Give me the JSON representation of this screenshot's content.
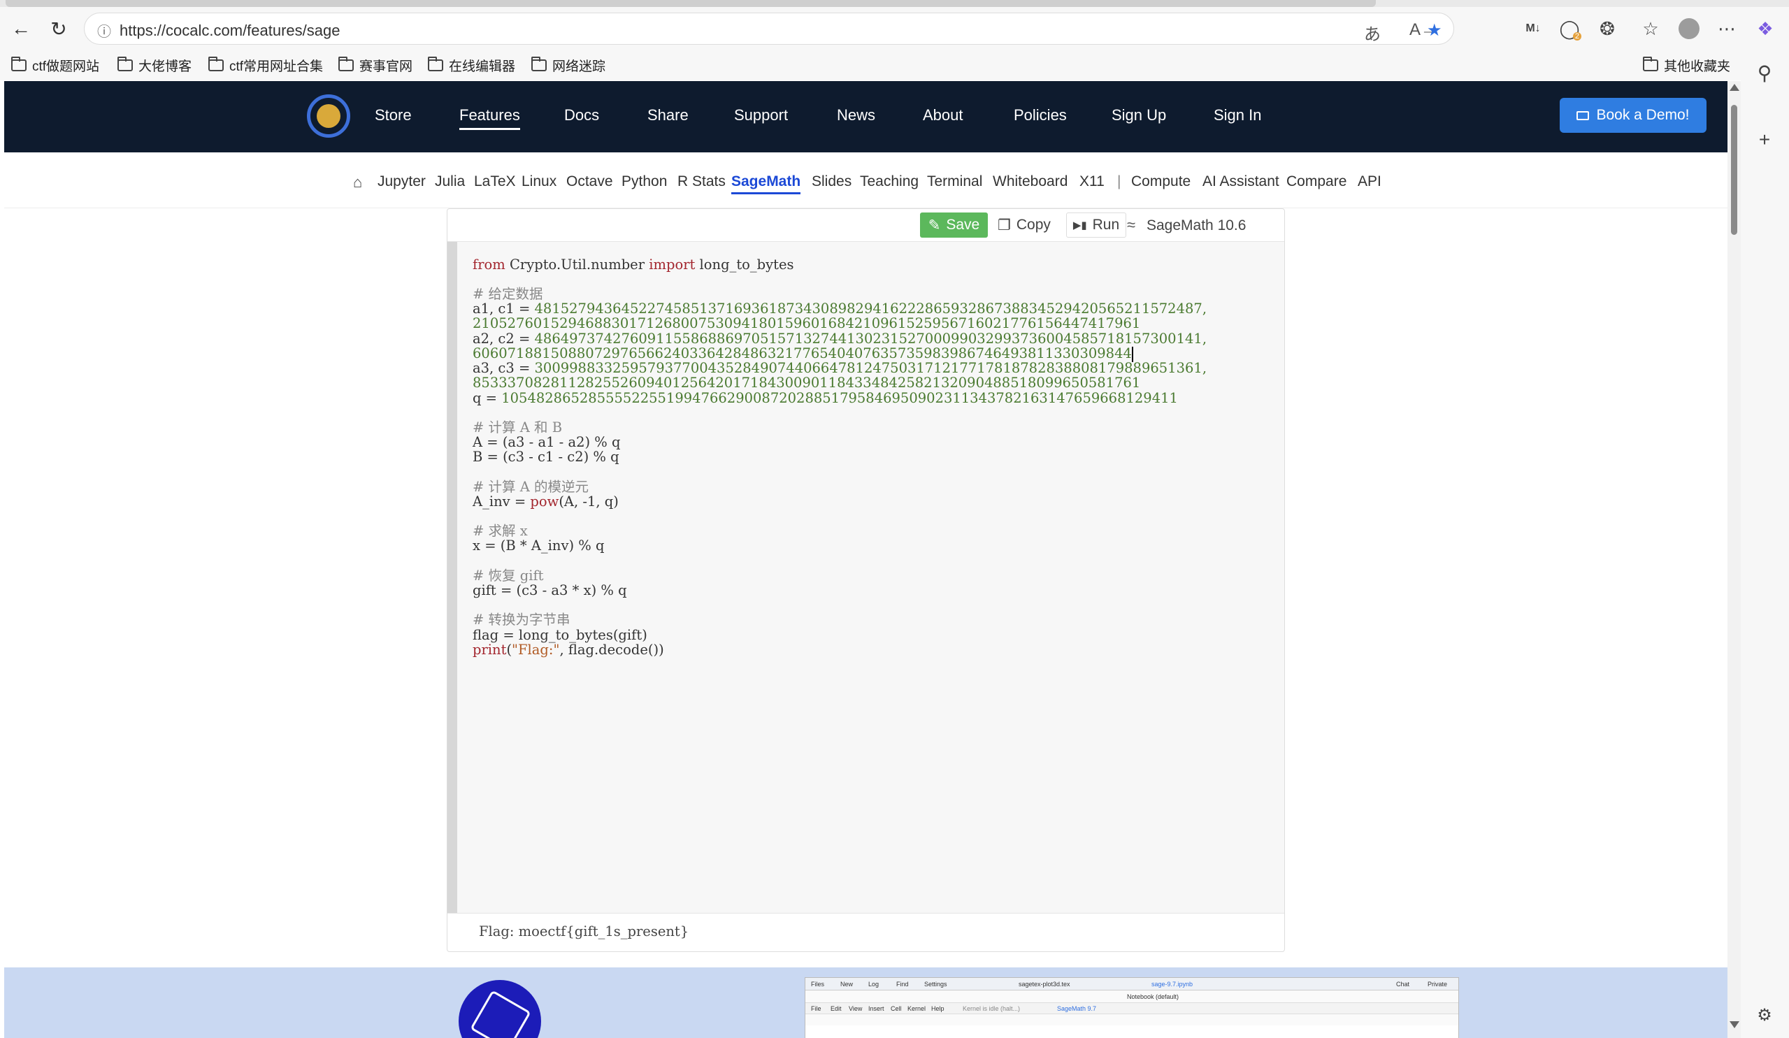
{
  "browser": {
    "url": "https://cocalc.com/features/sage",
    "bookmarks": [
      "ctf做题网站",
      "大佬博客",
      "ctf常用网址合集",
      "赛事官网",
      "在线编辑器",
      "网络迷踪"
    ],
    "other_bookmarks": "其他收藏夹",
    "extension_badge": "2"
  },
  "topnav": {
    "items": [
      "Store",
      "Features",
      "Docs",
      "Share",
      "Support",
      "News",
      "About",
      "Policies",
      "Sign Up",
      "Sign In"
    ],
    "active": "Features",
    "demo_button": "Book a Demo!"
  },
  "subnav": {
    "items": [
      "Jupyter",
      "Julia",
      "LaTeX",
      "Linux",
      "Octave",
      "Python",
      "R Stats",
      "SageMath",
      "Slides",
      "Teaching",
      "Terminal",
      "Whiteboard",
      "X11",
      "|",
      "Compute",
      "AI Assistant",
      "Compare",
      "API"
    ],
    "active": "SageMath"
  },
  "toolbar": {
    "save": "Save",
    "copy": "Copy",
    "run": "Run",
    "kernel": "SageMath 10.6"
  },
  "code": {
    "l1a": "from",
    "l1b": " Crypto.Util.number ",
    "l1c": "import",
    "l1d": " long_to_bytes",
    "c_given": "# 给定数据",
    "a1_lhs": "a1, c1 = ",
    "a1_val": "4815279436452274585137169361873430898294162228659328673883452942056521157248",
    "a1_tail": "7,",
    "a1_c": "2105276015294688301712680075309418015960168421096152595671602177615644741796",
    "a1_c_tail": "1",
    "a2_lhs": "a2, c2 = ",
    "a2_val": "4864973742760911558688697051571327441302315270009903299373600458571815730014",
    "a2_tail": "1,",
    "a2_c": "6060718815088072976566240336428486321776540407635735983986746493811330309844",
    "a3_lhs": "a3, c3 = ",
    "a3_val": "3009988332595793770043528490744066478124750317121771781878283880817988965136",
    "a3_tail": "1,",
    "a3_c": "8533370828112825526094012564201718430090118433484258213209048851809965058176",
    "a3_c_tail": "1",
    "q_lhs": "q = ",
    "q_val": "10548286528555522551994766290087202885179584695090231134378216314765966812941",
    "q_tail": "1",
    "c_calc_ab": "# 计算 A 和 B",
    "lineA": "A = (a3 - a1 - a2) % q",
    "lineB": "B = (c3 - c1 - c2) % q",
    "c_inv": "# 计算 A 的模逆元",
    "inv_a": "A_inv = ",
    "inv_fn": "pow",
    "inv_b": "(A, -1, q)",
    "c_x": "# 求解 x",
    "line_x": "x = (B * A_inv) % q",
    "c_gift": "# 恢复 gift",
    "line_gift": "gift = (c3 - a3 * x) % q",
    "c_conv": "# 转换为字节串",
    "line_flag": "flag = long_to_bytes(gift)",
    "print_fn": "print",
    "print_str": "\"Flag:\"",
    "print_rest": ", flag.decode())",
    "output": "Flag: moectf{gift_1s_present}"
  },
  "thumbnail": {
    "menu": [
      "Files",
      "New",
      "Log",
      "Find",
      "Settings"
    ],
    "tab1": "sagetex-plot3d.tex",
    "tab2": "sage-9.7.ipynb",
    "chat": "Chat",
    "private": "Private",
    "notebook": "Notebook (default)",
    "kernel_idle": "Kernel is idle (halt...)",
    "kernel_name": "SageMath 9.7",
    "menus2": [
      "File",
      "Edit",
      "View",
      "Insert",
      "Cell",
      "Kernel",
      "Help"
    ]
  }
}
